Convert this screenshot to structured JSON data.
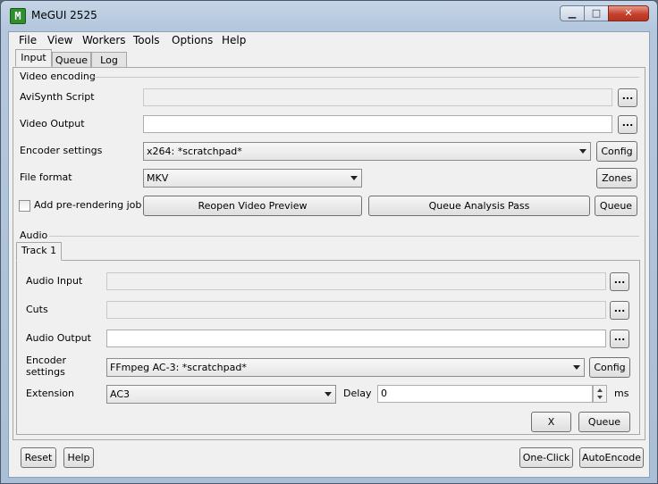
{
  "window": {
    "app_icon_glyph": "M",
    "title": "MeGUI 2525",
    "minimize_glyph": "▁",
    "maximize_glyph": "□",
    "close_glyph": "✕"
  },
  "menu": [
    "File",
    "View",
    "Workers",
    "Tools",
    "Options",
    "Help"
  ],
  "tabs": [
    {
      "label": "Input",
      "selected": true
    },
    {
      "label": "Queue",
      "selected": false
    },
    {
      "label": "Log",
      "selected": false
    }
  ],
  "video": {
    "section_title": "Video encoding",
    "avisynth_label": "AviSynth Script",
    "avisynth_value": "",
    "video_output_label": "Video Output",
    "video_output_value": "",
    "encoder_settings_label": "Encoder settings",
    "encoder_settings_value": "x264: *scratchpad*",
    "config_label": "Config",
    "file_format_label": "File format",
    "file_format_value": "MKV",
    "zones_label": "Zones",
    "add_prerender_label": "Add pre-rendering job",
    "reopen_preview_label": "Reopen Video Preview",
    "queue_analysis_label": "Queue Analysis Pass",
    "queue_label": "Queue",
    "browse_label": "..."
  },
  "audio": {
    "section_title": "Audio",
    "track_tab": "Track 1",
    "audio_input_label": "Audio Input",
    "audio_input_value": "",
    "cuts_label": "Cuts",
    "cuts_value": "",
    "audio_output_label": "Audio Output",
    "audio_output_value": "",
    "encoder_settings_label_1": "Encoder",
    "encoder_settings_label_2": "settings",
    "encoder_settings_value": "FFmpeg AC-3: *scratchpad*",
    "config_label": "Config",
    "extension_label": "Extension",
    "extension_value": "AC3",
    "delay_label": "Delay",
    "delay_value": "0",
    "delay_unit": "ms",
    "x_label": "X",
    "queue_label": "Queue",
    "browse_label": "..."
  },
  "bottom": {
    "reset_label": "Reset",
    "help_label": "Help",
    "one_click_label": "One-Click",
    "autoencode_label": "AutoEncode"
  }
}
